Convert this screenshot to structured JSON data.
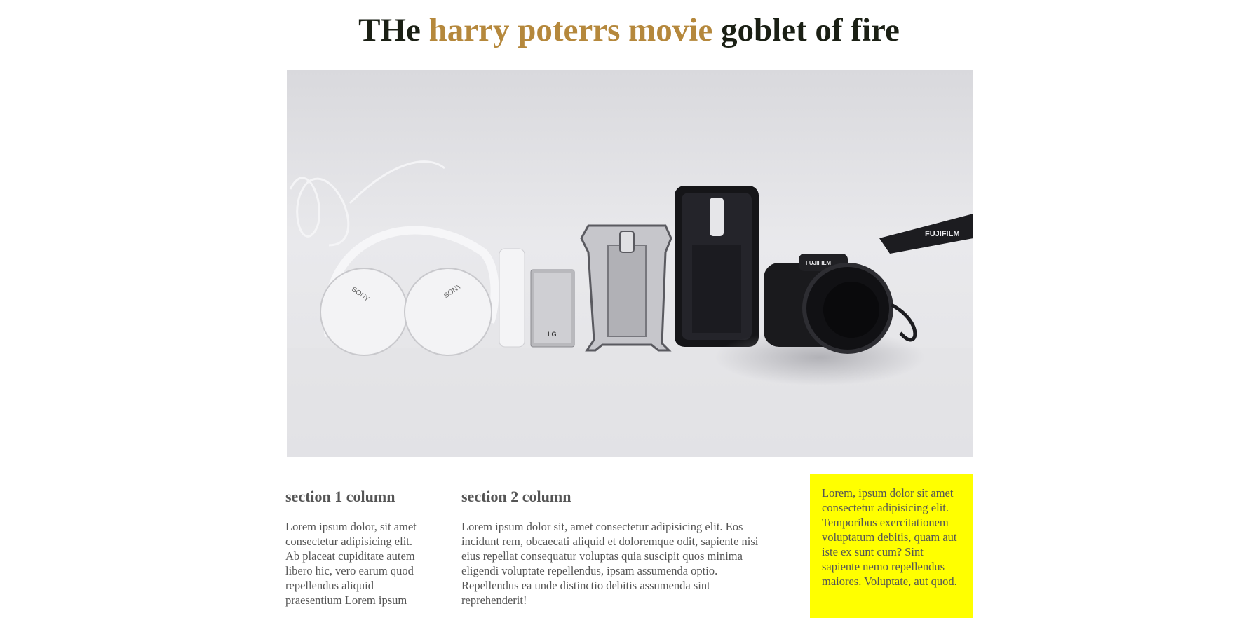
{
  "header": {
    "title_part1": "THe",
    "title_part2": "harry poterrs movie",
    "title_part3": "goblet of fire",
    "accent_color": "#b5883c",
    "text_color": "#1a1f14"
  },
  "hero": {
    "image": "flat-lay-electronics-photo",
    "headphones_brand": "SONY",
    "battery_brand": "LG",
    "camera_brand": "FUJIFILM"
  },
  "sections": [
    {
      "heading": "section 1 column",
      "body": "Lorem ipsum dolor, sit amet consectetur adipisicing elit. Ab placeat cupiditate autem libero hic, vero earum quod repellendus aliquid praesentium Lorem ipsum"
    },
    {
      "heading": "section 2 column",
      "body": "Lorem ipsum dolor sit, amet consectetur adipisicing elit. Eos incidunt rem, obcaecati aliquid et doloremque odit, sapiente nisi eius repellat consequatur voluptas quia suscipit quos minima eligendi voluptate repellendus, ipsam assumenda optio. Repellendus ea unde distinctio debitis assumenda sint reprehenderit!"
    },
    {
      "body": "Lorem, ipsum dolor sit amet consectetur adipisicing elit. Temporibus exercitationem voluptatum debitis, quam aut iste ex sunt cum? Sint sapiente nemo repellendus maiores. Voluptate, aut quod.",
      "background": "#ffff00"
    }
  ]
}
